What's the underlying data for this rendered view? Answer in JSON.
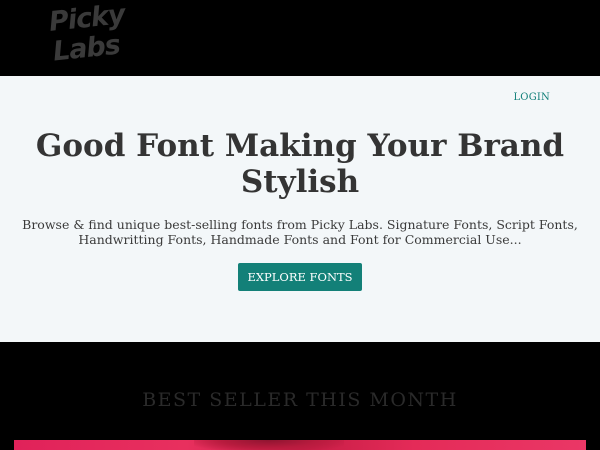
{
  "header": {
    "logo_line1": "Picky",
    "logo_line2": "Labs"
  },
  "hero": {
    "login_label": "LOGIN",
    "title": "Good Font Making Your Brand Stylish",
    "description": "Browse & find unique best-selling fonts from Picky Labs. Signature Fonts, Script Fonts, Handwritting Fonts, Handmade Fonts and Font for Commercial Use...",
    "cta_label": "EXPLORE FONTS"
  },
  "best_seller": {
    "heading": "BEST SELLER THIS MONTH"
  },
  "colors": {
    "accent": "#138078",
    "hero_bg": "#f3f7f9",
    "page_bg": "#000000",
    "banner_pink": "#e0225a"
  }
}
